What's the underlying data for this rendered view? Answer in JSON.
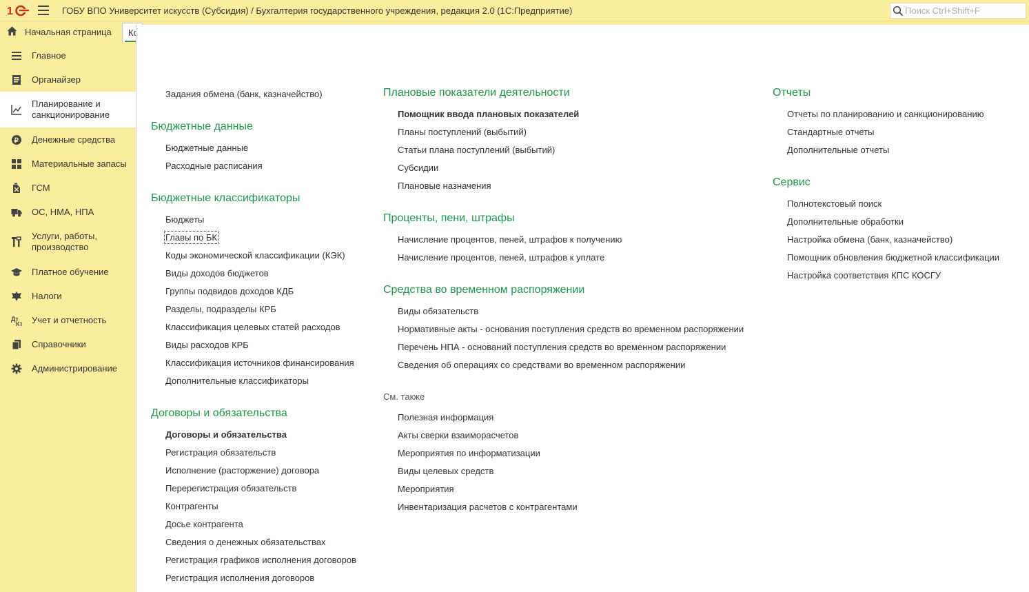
{
  "app": {
    "title": "ГОБУ ВПО Университет искусств (Субсидия) / Бухгалтерия государственного учреждения, редакция 2.0  (1С:Предприятие)",
    "search_placeholder": "Поиск Ctrl+Shift+F"
  },
  "tabs": {
    "home": "Начальная страница",
    "active": "Ко"
  },
  "sidebar": {
    "items": [
      {
        "label": "Главное",
        "icon": "hamburger-list-icon"
      },
      {
        "label": "Органайзер",
        "icon": "notepad-icon"
      },
      {
        "label": "Планирование и санкционирование",
        "icon": "planning-chart-icon"
      },
      {
        "label": "Денежные средства",
        "icon": "ruble-coin-icon"
      },
      {
        "label": "Материальные запасы",
        "icon": "grid-blocks-icon"
      },
      {
        "label": "ГСМ",
        "icon": "fuel-can-icon"
      },
      {
        "label": "ОС, НМА, НПА",
        "icon": "truck-icon"
      },
      {
        "label": "Услуги, работы, производство",
        "icon": "tools-icon"
      },
      {
        "label": "Платное обучение",
        "icon": "graduation-cap-icon"
      },
      {
        "label": "Налоги",
        "icon": "eagle-emblem-icon"
      },
      {
        "label": "Учет и отчетность",
        "icon": "debit-credit-icon"
      },
      {
        "label": "Справочники",
        "icon": "books-icon"
      },
      {
        "label": "Администрирование",
        "icon": "gear-icon"
      }
    ]
  },
  "col1": {
    "top_link": "Задания обмена (банк, казначейство)",
    "budget_data": {
      "title": "Бюджетные данные",
      "items": [
        "Бюджетные данные",
        "Расходные расписания"
      ]
    },
    "classifiers": {
      "title": "Бюджетные классификаторы",
      "items": [
        "Бюджеты",
        "Главы по БК",
        "Коды экономической классификации (КЭК)",
        "Виды доходов бюджетов",
        "Группы подвидов доходов КДБ",
        "Разделы, подразделы КРБ",
        "Классификация целевых статей расходов",
        "Виды расходов КРБ",
        "Классификация источников финансирования",
        "Дополнительные классификаторы"
      ]
    },
    "contracts": {
      "title": "Договоры и обязательства",
      "items": [
        "Договоры и обязательства",
        "Регистрация обязательств",
        "Исполнение (расторжение) договора",
        "Перерегистрация обязательств",
        "Контрагенты",
        "Досье контрагента",
        "Сведения о денежных обязательствах",
        "Регистрация графиков исполнения договоров",
        "Регистрация исполнения договоров"
      ]
    }
  },
  "col2": {
    "planned": {
      "title": "Плановые показатели деятельности",
      "items": [
        "Помощник ввода плановых показателей",
        "Планы поступлений (выбытий)",
        "Статьи плана поступлений (выбытий)",
        "Субсидии",
        "Плановые назначения"
      ]
    },
    "penalties": {
      "title": "Проценты, пени, штрафы",
      "items": [
        "Начисление процентов, пеней, штрафов к получению",
        "Начисление процентов, пеней, штрафов к уплате"
      ]
    },
    "temporary": {
      "title": "Средства во временном распоряжении",
      "items": [
        "Виды обязательств",
        "Нормативные акты - основания  поступления средств во временном распоряжении",
        "Перечень НПА - оснований поступления средств во временном распоряжении",
        "Сведения об операциях со средствами во временном распоряжении"
      ]
    },
    "see_also": {
      "title": "См. также",
      "items": [
        "Полезная информация",
        "Акты сверки взаиморасчетов",
        "Мероприятия по информатизации",
        "Виды целевых средств",
        "Мероприятия",
        "Инвентаризация расчетов с контрагентами"
      ]
    }
  },
  "col3": {
    "reports": {
      "title": "Отчеты",
      "items": [
        "Отчеты по планированию и санкционированию",
        "Стандартные отчеты",
        "Дополнительные отчеты"
      ]
    },
    "service": {
      "title": "Сервис",
      "items": [
        "Полнотекстовый поиск",
        "Дополнительные обработки",
        "Настройка обмена (банк, казначейство)",
        "Помощник обновления бюджетной классификации",
        "Настройка соответствия КПС КОСГУ"
      ]
    }
  },
  "colors": {
    "accent_green": "#1e9b4a",
    "panel_yellow": "#fbed9e",
    "logo_red": "#d52b1e"
  }
}
